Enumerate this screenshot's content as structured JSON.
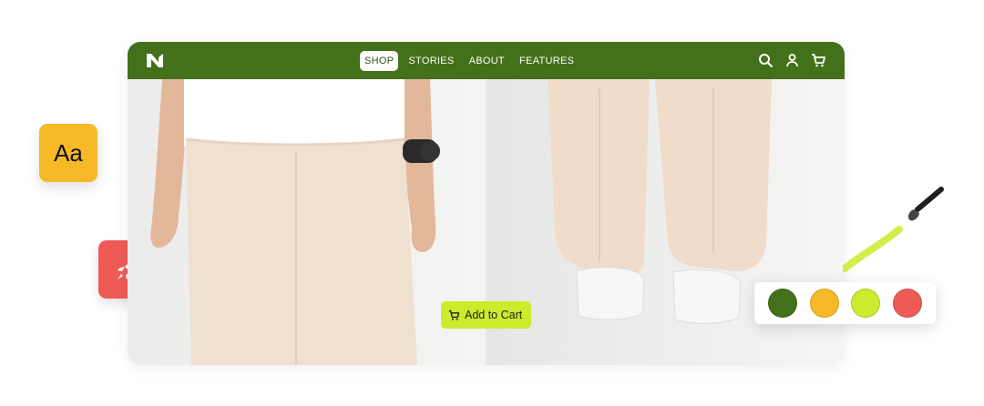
{
  "navbar": {
    "logo_icon": "n-logo",
    "items": [
      {
        "label": "SHOP",
        "active": true
      },
      {
        "label": "STORIES",
        "active": false
      },
      {
        "label": "ABOUT",
        "active": false
      },
      {
        "label": "FEATURES",
        "active": false
      }
    ],
    "icons": [
      "search-icon",
      "user-icon",
      "cart-icon"
    ],
    "background": "#43701a"
  },
  "hero": {
    "cta_label": "Add to Cart",
    "cta_color": "#cbeb2c"
  },
  "floating": {
    "font_tile_text": "Aa",
    "font_tile_color": "#f7b926",
    "rocket_tile_color": "#f05a55",
    "swatches": [
      "#43701a",
      "#f7b926",
      "#cbeb2c",
      "#f05a55"
    ]
  }
}
